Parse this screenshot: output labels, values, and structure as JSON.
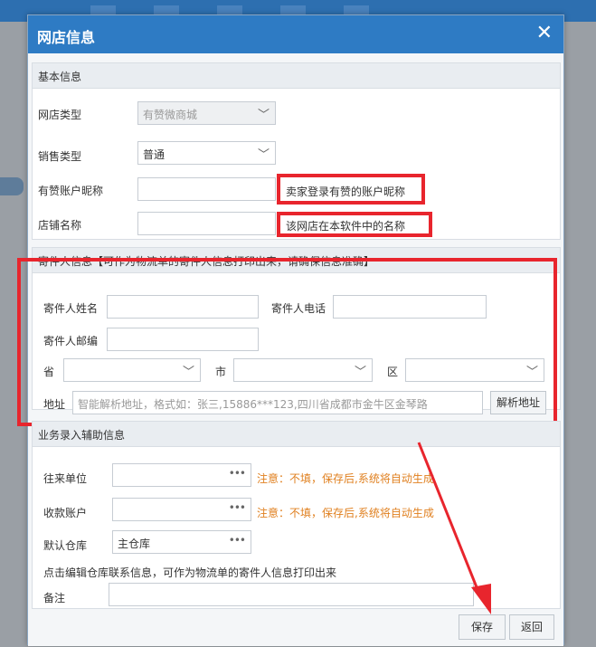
{
  "dialog": {
    "title": "网店信息",
    "close_icon": "close-icon"
  },
  "basic": {
    "header": "基本信息",
    "shop_type": {
      "label": "网店类型",
      "value": "有赞微商城"
    },
    "sale_type": {
      "label": "销售类型",
      "value": "普通"
    },
    "account_nick": {
      "label": "有赞账户昵称",
      "value": "",
      "hint": "卖家登录有赞的账户昵称"
    },
    "shop_name": {
      "label": "店铺名称",
      "value": "",
      "hint": "该网店在本软件中的名称"
    }
  },
  "sender": {
    "header": "寄件人信息【可作为物流单的寄件人信息打印出来，请确保信息准确】",
    "name_label": "寄件人姓名",
    "phone_label": "寄件人电话",
    "zip_label": "寄件人邮编",
    "province_label": "省",
    "city_label": "市",
    "district_label": "区",
    "address_label": "地址",
    "address_placeholder": "智能解析地址，格式如：张三,15886***123,四川省成都市金牛区金琴路",
    "parse_button": "解析地址"
  },
  "business": {
    "header": "业务录入辅助信息",
    "partner": {
      "label": "往来单位",
      "note": "注意：不填，保存后,系统将自动生成"
    },
    "account": {
      "label": "收款账户",
      "note": "注意：不填，保存后,系统将自动生成"
    },
    "warehouse": {
      "label": "默认仓库",
      "value": "主仓库"
    },
    "tip": "点击编辑仓库联系信息，可作为物流单的寄件人信息打印出来",
    "remark_label": "备注"
  },
  "footer": {
    "save": "保存",
    "back": "返回"
  },
  "colors": {
    "title_bar": "#2e7bc4",
    "highlight": "#e8252d",
    "note": "#e08020"
  }
}
